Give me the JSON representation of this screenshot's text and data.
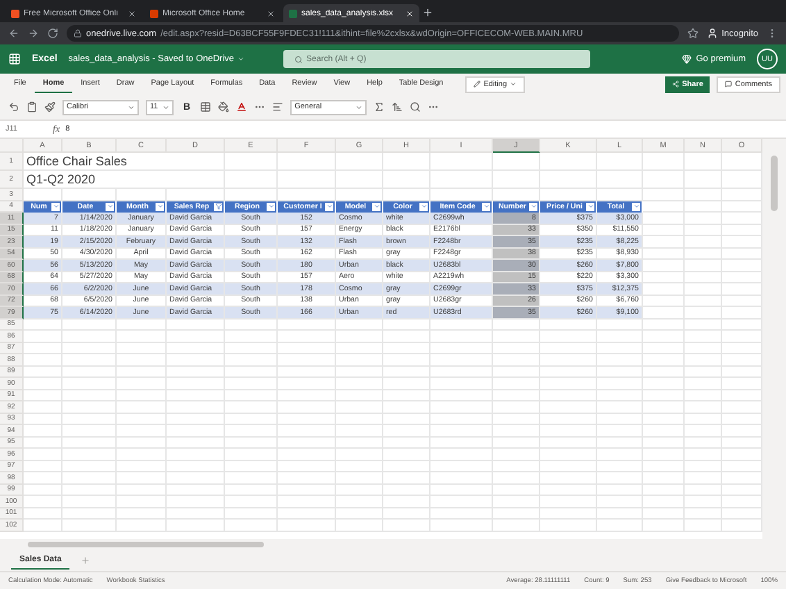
{
  "browser": {
    "tabs": [
      {
        "title": "Free Microsoft Office Onli",
        "selected": false
      },
      {
        "title": "Microsoft Office Home",
        "selected": false
      },
      {
        "title": "sales_data_analysis.xlsx",
        "selected": true
      }
    ],
    "url": {
      "host": "onedrive.live.com",
      "path": "/edit.aspx?resid=D63BCF55F9FDEC31!111&ithint=file%2cxlsx&wdOrigin=OFFICECOM-WEB.MAIN.MRU"
    },
    "profile": "Incognito"
  },
  "app": {
    "name": "Excel",
    "document": "sales_data_analysis - Saved to OneDrive",
    "search": {
      "placeholder": "Search (Alt + Q)"
    },
    "premium": "Go premium",
    "avatar": "UU"
  },
  "ribbon": {
    "tabs": [
      {
        "label": "File",
        "selected": false
      },
      {
        "label": "Home",
        "selected": true
      },
      {
        "label": "Insert",
        "selected": false
      },
      {
        "label": "Draw",
        "selected": false
      },
      {
        "label": "Page Layout",
        "selected": false
      },
      {
        "label": "Formulas",
        "selected": false
      },
      {
        "label": "Data",
        "selected": false
      },
      {
        "label": "Review",
        "selected": false
      },
      {
        "label": "View",
        "selected": false
      },
      {
        "label": "Help",
        "selected": false
      },
      {
        "label": "Table Design",
        "selected": false
      }
    ],
    "editing": "Editing",
    "share": "Share",
    "comments": "Comments",
    "toolbar": {
      "font": "Calibri",
      "size": "11",
      "bold": "B",
      "format": "General"
    }
  },
  "formula_bar": {
    "cell": "J11",
    "function_label": "fx",
    "value": "8"
  },
  "columns": [
    {
      "letter": "A",
      "selected": false
    },
    {
      "letter": "B",
      "selected": false
    },
    {
      "letter": "C",
      "selected": false
    },
    {
      "letter": "D",
      "selected": false
    },
    {
      "letter": "E",
      "selected": false
    },
    {
      "letter": "F",
      "selected": false
    },
    {
      "letter": "G",
      "selected": false
    },
    {
      "letter": "H",
      "selected": false
    },
    {
      "letter": "I",
      "selected": false
    },
    {
      "letter": "J",
      "selected": true
    },
    {
      "letter": "K",
      "selected": false
    },
    {
      "letter": "L",
      "selected": false
    },
    {
      "letter": "M",
      "selected": false
    },
    {
      "letter": "N",
      "selected": false
    },
    {
      "letter": "O",
      "selected": false
    }
  ],
  "table": {
    "columns": [
      {
        "label": "Num",
        "filtered": false
      },
      {
        "label": "Date",
        "filtered": false
      },
      {
        "label": "Month",
        "filtered": false
      },
      {
        "label": "Sales Rep",
        "filtered": true
      },
      {
        "label": "Region",
        "filtered": false
      },
      {
        "label": "Customer I",
        "filtered": false
      },
      {
        "label": "Model",
        "filtered": false
      },
      {
        "label": "Color",
        "filtered": false
      },
      {
        "label": "Item Code",
        "filtered": false
      },
      {
        "label": "Number",
        "filtered": false
      },
      {
        "label": "Price / Uni",
        "filtered": false
      },
      {
        "label": "Total",
        "filtered": false
      }
    ]
  },
  "rows": [
    {
      "number": "1",
      "kind": "title",
      "text": "Office Chair Sales"
    },
    {
      "number": "2",
      "kind": "title",
      "text": "Q1-Q2 2020"
    },
    {
      "number": "3",
      "kind": "blank"
    },
    {
      "number": "4",
      "kind": "header"
    },
    {
      "number": "11",
      "kind": "data",
      "selected": true,
      "cells": [
        "7",
        "1/14/2020",
        "January",
        "David Garcia",
        "South",
        "152",
        "Cosmo",
        "white",
        "C2699wh",
        "8",
        "$375",
        "$3,000"
      ]
    },
    {
      "number": "15",
      "kind": "data",
      "selected": true,
      "cells": [
        "11",
        "1/18/2020",
        "January",
        "David Garcia",
        "South",
        "157",
        "Energy",
        "black",
        "E2176bl",
        "33",
        "$350",
        "$11,550"
      ]
    },
    {
      "number": "23",
      "kind": "data",
      "selected": true,
      "cells": [
        "19",
        "2/15/2020",
        "February",
        "David Garcia",
        "South",
        "132",
        "Flash",
        "brown",
        "F2248br",
        "35",
        "$235",
        "$8,225"
      ]
    },
    {
      "number": "54",
      "kind": "data",
      "selected": true,
      "cells": [
        "50",
        "4/30/2020",
        "April",
        "David Garcia",
        "South",
        "162",
        "Flash",
        "gray",
        "F2248gr",
        "38",
        "$235",
        "$8,930"
      ]
    },
    {
      "number": "60",
      "kind": "data",
      "selected": true,
      "cells": [
        "56",
        "5/13/2020",
        "May",
        "David Garcia",
        "South",
        "180",
        "Urban",
        "black",
        "U2683bl",
        "30",
        "$260",
        "$7,800"
      ]
    },
    {
      "number": "68",
      "kind": "data",
      "selected": true,
      "cells": [
        "64",
        "5/27/2020",
        "May",
        "David Garcia",
        "South",
        "157",
        "Aero",
        "white",
        "A2219wh",
        "15",
        "$220",
        "$3,300"
      ]
    },
    {
      "number": "70",
      "kind": "data",
      "selected": true,
      "cells": [
        "66",
        "6/2/2020",
        "June",
        "David Garcia",
        "South",
        "178",
        "Cosmo",
        "gray",
        "C2699gr",
        "33",
        "$375",
        "$12,375"
      ]
    },
    {
      "number": "72",
      "kind": "data",
      "selected": true,
      "cells": [
        "68",
        "6/5/2020",
        "June",
        "David Garcia",
        "South",
        "138",
        "Urban",
        "gray",
        "U2683gr",
        "26",
        "$260",
        "$6,760"
      ]
    },
    {
      "number": "79",
      "kind": "data",
      "selected": true,
      "cells": [
        "75",
        "6/14/2020",
        "June",
        "David Garcia",
        "South",
        "166",
        "Urban",
        "red",
        "U2683rd",
        "35",
        "$260",
        "$9,100"
      ]
    },
    {
      "number": "85",
      "kind": "blank"
    },
    {
      "number": "86",
      "kind": "blank"
    },
    {
      "number": "87",
      "kind": "blank"
    },
    {
      "number": "88",
      "kind": "blank"
    },
    {
      "number": "89",
      "kind": "blank"
    },
    {
      "number": "90",
      "kind": "blank"
    },
    {
      "number": "91",
      "kind": "blank"
    },
    {
      "number": "92",
      "kind": "blank"
    },
    {
      "number": "93",
      "kind": "blank"
    },
    {
      "number": "94",
      "kind": "blank"
    },
    {
      "number": "95",
      "kind": "blank"
    },
    {
      "number": "96",
      "kind": "blank"
    },
    {
      "number": "97",
      "kind": "blank"
    },
    {
      "number": "98",
      "kind": "blank"
    },
    {
      "number": "99",
      "kind": "blank"
    },
    {
      "number": "100",
      "kind": "blank"
    },
    {
      "number": "101",
      "kind": "blank"
    },
    {
      "number": "102",
      "kind": "blank"
    }
  ],
  "sheet_tabs": [
    {
      "label": "Sales Data",
      "selected": true
    }
  ],
  "status_bar": {
    "calculation": "Calculation Mode: Automatic",
    "statistics": "Workbook Statistics",
    "average": "Average: 28.11111111",
    "count": "Count: 9",
    "sum": "Sum: 253",
    "feedback": "Give Feedback to Microsoft",
    "zoom": "100%"
  }
}
